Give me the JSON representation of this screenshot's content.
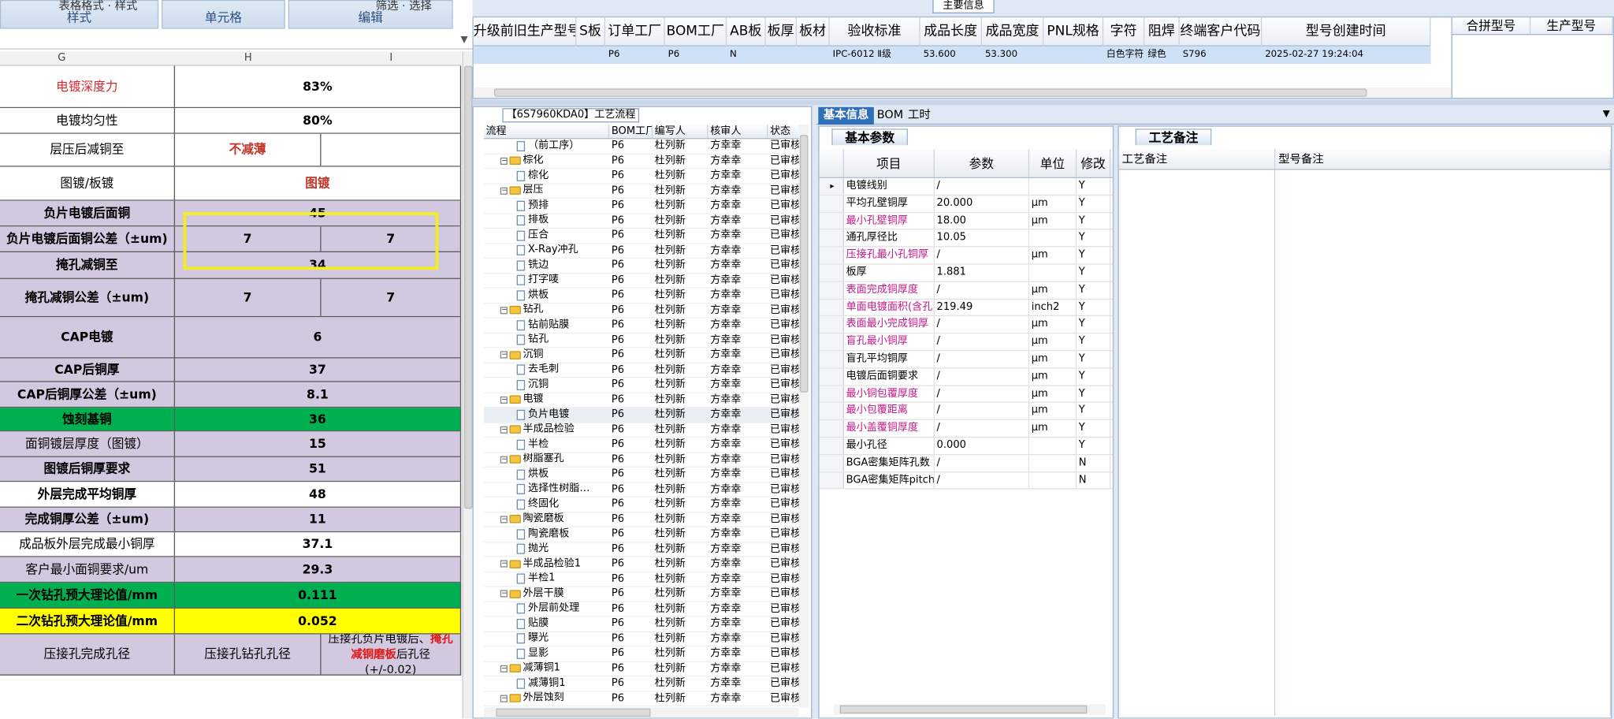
{
  "excel": {
    "ribbon": [
      {
        "label": "样式",
        "top": "表格格式 · 样式"
      },
      {
        "label": "单元格",
        "top": ""
      },
      {
        "label": "编辑",
        "top": "筛选 · 选择"
      }
    ],
    "columns": [
      "G",
      "H",
      "I"
    ],
    "rows": [
      {
        "label": "电镀深度力",
        "v": "83%",
        "bg": "#ffffff",
        "labelColor": "#d7262e",
        "bold": false
      },
      {
        "label": "电镀均匀性",
        "v": "80%",
        "bg": "#ffffff",
        "bold": false
      },
      {
        "label": "层压后减铜至",
        "h": "不减薄",
        "bg": "#ffffff",
        "hColor": "#c0392b",
        "bold": false
      },
      {
        "label": "图镀/板镀",
        "v": "图镀",
        "bg": "#ffffff",
        "vColor": "#c0392b",
        "bold": false
      },
      {
        "label": "负片电镀后面铜",
        "v": "45",
        "bg": "#d2c8df",
        "bold": true
      },
      {
        "label": "负片电镀后面铜公差（±um)",
        "h": "7",
        "i": "7",
        "bg": "#d2c8df",
        "bold": true
      },
      {
        "label": "掩孔减铜至",
        "v": "34",
        "bg": "#d2c8df",
        "bold": true
      },
      {
        "label": "掩孔减铜公差（±um)",
        "h": "7",
        "i": "7",
        "bg": "#d2c8df",
        "bold": true
      },
      {
        "label": "CAP电镀",
        "v": "6",
        "bg": "#d2c8df",
        "bold": true
      },
      {
        "label": "CAP后铜厚",
        "v": "37",
        "bg": "#d2c8df",
        "bold": true
      },
      {
        "label": "CAP后铜厚公差（±um)",
        "v": "8.1",
        "bg": "#d2c8df",
        "bold": true
      },
      {
        "label": "蚀刻基铜",
        "v": "36",
        "bg": "#00b050",
        "bold": true
      },
      {
        "label": "面铜镀层厚度（图镀）",
        "v": "15",
        "bg": "#d2c8df",
        "bold": false
      },
      {
        "label": "图镀后铜厚要求",
        "v": "51",
        "bg": "#d2c8df",
        "bold": true
      },
      {
        "label": "外层完成平均铜厚",
        "v": "48",
        "bg": "#ffffff",
        "bold": true
      },
      {
        "label": "完成铜厚公差（±um)",
        "v": "11",
        "bg": "#d2c8df",
        "bold": true
      },
      {
        "label": "成品板外层完成最小铜厚",
        "v": "37.1",
        "bg": "#ffffff",
        "bold": false
      },
      {
        "label": "客户最小面铜要求/um",
        "v": "29.3",
        "bg": "#d2c8df",
        "bold": false
      },
      {
        "label": "一次钻孔预大理论值/mm",
        "v": "0.111",
        "bg": "#00b050",
        "bold": true
      },
      {
        "label": "二次钻孔预大理论值/mm",
        "v": "0.052",
        "bg": "#ffff00",
        "bold": true
      },
      {
        "label": "压接孔完成孔径",
        "h": "压接孔钻孔孔径",
        "i1": "压接孔负片电镀后、",
        "i2": "掩孔",
        "i3": "减铜磨板",
        "i4": "后孔径",
        "i5": "(+/-0.02)",
        "bg": "#d2c8df",
        "bold": false
      }
    ]
  },
  "app": {
    "main_header": "主要信息",
    "top_columns": [
      "升级前旧生产型号",
      "S板",
      "订单工厂",
      "BOM工厂",
      "AB板",
      "板厚",
      "板材",
      "验收标准",
      "成品长度",
      "成品宽度",
      "PNL规格",
      "字符",
      "阻焊",
      "终端客户代码",
      "型号创建时间"
    ],
    "top_row": [
      "",
      "",
      "P6",
      "P6",
      "N",
      "",
      "",
      "IPC-6012 Ⅱ级",
      "53.600",
      "53.300",
      "",
      "白色字符",
      "绿色",
      "S796",
      "2025-02-27 19:24:04"
    ],
    "side_columns": [
      "合拼型号",
      "生产型号"
    ],
    "process": {
      "caption": "【6S7960KDA0】工艺流程",
      "headers": [
        "流程",
        "BOM工厂",
        "编写人",
        "核审人",
        "状态"
      ],
      "rows": [
        {
          "name": "（前工序）",
          "lvl": 2,
          "f": "P6",
          "w": "杜列新",
          "r": "方幸幸",
          "s": "已审核"
        },
        {
          "name": "棕化",
          "lvl": 1,
          "f": "P6",
          "w": "杜列新",
          "r": "方幸幸",
          "s": "已审核"
        },
        {
          "name": "棕化",
          "lvl": 2,
          "f": "P6",
          "w": "杜列新",
          "r": "方幸幸",
          "s": "已审核"
        },
        {
          "name": "层压",
          "lvl": 1,
          "f": "P6",
          "w": "杜列新",
          "r": "方幸幸",
          "s": "已审核"
        },
        {
          "name": "预排",
          "lvl": 2,
          "f": "P6",
          "w": "杜列新",
          "r": "方幸幸",
          "s": "已审核"
        },
        {
          "name": "排板",
          "lvl": 2,
          "f": "P6",
          "w": "杜列新",
          "r": "方幸幸",
          "s": "已审核"
        },
        {
          "name": "压合",
          "lvl": 2,
          "f": "P6",
          "w": "杜列新",
          "r": "方幸幸",
          "s": "已审核"
        },
        {
          "name": "X-Ray冲孔",
          "lvl": 2,
          "f": "P6",
          "w": "杜列新",
          "r": "方幸幸",
          "s": "已审核"
        },
        {
          "name": "铣边",
          "lvl": 2,
          "f": "P6",
          "w": "杜列新",
          "r": "方幸幸",
          "s": "已审核"
        },
        {
          "name": "打字唛",
          "lvl": 2,
          "f": "P6",
          "w": "杜列新",
          "r": "方幸幸",
          "s": "已审核"
        },
        {
          "name": "烘板",
          "lvl": 2,
          "f": "P6",
          "w": "杜列新",
          "r": "方幸幸",
          "s": "已审核"
        },
        {
          "name": "钻孔",
          "lvl": 1,
          "f": "P6",
          "w": "杜列新",
          "r": "方幸幸",
          "s": "已审核"
        },
        {
          "name": "钻前贴膜",
          "lvl": 2,
          "f": "P6",
          "w": "杜列新",
          "r": "方幸幸",
          "s": "已审核"
        },
        {
          "name": "钻孔",
          "lvl": 2,
          "f": "P6",
          "w": "杜列新",
          "r": "方幸幸",
          "s": "已审核"
        },
        {
          "name": "沉铜",
          "lvl": 1,
          "f": "P6",
          "w": "杜列新",
          "r": "方幸幸",
          "s": "已审核"
        },
        {
          "name": "去毛刺",
          "lvl": 2,
          "f": "P6",
          "w": "杜列新",
          "r": "方幸幸",
          "s": "已审核"
        },
        {
          "name": "沉铜",
          "lvl": 2,
          "f": "P6",
          "w": "杜列新",
          "r": "方幸幸",
          "s": "已审核"
        },
        {
          "name": "电镀",
          "lvl": 1,
          "f": "P6",
          "w": "杜列新",
          "r": "方幸幸",
          "s": "已审核"
        },
        {
          "name": "负片电镀",
          "lvl": 2,
          "f": "P6",
          "w": "杜列新",
          "r": "方幸幸",
          "s": "已审核",
          "sel": true
        },
        {
          "name": "半成品检验",
          "lvl": 1,
          "f": "P6",
          "w": "杜列新",
          "r": "方幸幸",
          "s": "已审核"
        },
        {
          "name": "半检",
          "lvl": 2,
          "f": "P6",
          "w": "杜列新",
          "r": "方幸幸",
          "s": "已审核"
        },
        {
          "name": "树脂塞孔",
          "lvl": 1,
          "f": "P6",
          "w": "杜列新",
          "r": "方幸幸",
          "s": "已审核"
        },
        {
          "name": "烘板",
          "lvl": 2,
          "f": "P6",
          "w": "杜列新",
          "r": "方幸幸",
          "s": "已审核"
        },
        {
          "name": "选择性树脂…",
          "lvl": 2,
          "f": "P6",
          "w": "杜列新",
          "r": "方幸幸",
          "s": "已审核"
        },
        {
          "name": "终固化",
          "lvl": 2,
          "f": "P6",
          "w": "杜列新",
          "r": "方幸幸",
          "s": "已审核"
        },
        {
          "name": "陶瓷磨板",
          "lvl": 1,
          "f": "P6",
          "w": "杜列新",
          "r": "方幸幸",
          "s": "已审核"
        },
        {
          "name": "陶瓷磨板",
          "lvl": 2,
          "f": "P6",
          "w": "杜列新",
          "r": "方幸幸",
          "s": "已审核"
        },
        {
          "name": "抛光",
          "lvl": 2,
          "f": "P6",
          "w": "杜列新",
          "r": "方幸幸",
          "s": "已审核"
        },
        {
          "name": "半成品检验1",
          "lvl": 1,
          "f": "P6",
          "w": "杜列新",
          "r": "方幸幸",
          "s": "已审核"
        },
        {
          "name": "半检1",
          "lvl": 2,
          "f": "P6",
          "w": "杜列新",
          "r": "方幸幸",
          "s": "已审核"
        },
        {
          "name": "外层干膜",
          "lvl": 1,
          "f": "P6",
          "w": "杜列新",
          "r": "方幸幸",
          "s": "已审核"
        },
        {
          "name": "外层前处理",
          "lvl": 2,
          "f": "P6",
          "w": "杜列新",
          "r": "方幸幸",
          "s": "已审核"
        },
        {
          "name": "贴膜",
          "lvl": 2,
          "f": "P6",
          "w": "杜列新",
          "r": "方幸幸",
          "s": "已审核"
        },
        {
          "name": "曝光",
          "lvl": 2,
          "f": "P6",
          "w": "杜列新",
          "r": "方幸幸",
          "s": "已审核"
        },
        {
          "name": "显影",
          "lvl": 2,
          "f": "P6",
          "w": "杜列新",
          "r": "方幸幸",
          "s": "已审核"
        },
        {
          "name": "减薄铜1",
          "lvl": 1,
          "f": "P6",
          "w": "杜列新",
          "r": "方幸幸",
          "s": "已审核"
        },
        {
          "name": "减薄铜1",
          "lvl": 2,
          "f": "P6",
          "w": "杜列新",
          "r": "方幸幸",
          "s": "已审核"
        },
        {
          "name": "外层蚀刻",
          "lvl": 1,
          "f": "P6",
          "w": "杜列新",
          "r": "方幸幸",
          "s": "已审核"
        }
      ]
    },
    "tabs": [
      "基本信息",
      "BOM",
      "工时"
    ],
    "basic": {
      "section": "基本参数",
      "headers": [
        "项目",
        "参数",
        "单位",
        "修改"
      ],
      "rows": [
        {
          "item": "电镀线别",
          "val": "/",
          "unit": "",
          "mod": "Y",
          "pink": false,
          "cur": true
        },
        {
          "item": "平均孔壁铜厚",
          "val": "20.000",
          "unit": "μm",
          "mod": "Y",
          "pink": false
        },
        {
          "item": "最小孔壁铜厚",
          "val": "18.00",
          "unit": "μm",
          "mod": "Y",
          "pink": true
        },
        {
          "item": "通孔厚径比",
          "val": "10.05",
          "unit": "",
          "mod": "Y",
          "pink": false
        },
        {
          "item": "压接孔最小孔铜厚",
          "val": "/",
          "unit": "μm",
          "mod": "Y",
          "pink": true
        },
        {
          "item": "板厚",
          "val": "1.881",
          "unit": "",
          "mod": "Y",
          "pink": false
        },
        {
          "item": "表面完成铜厚度",
          "val": "/",
          "unit": "μm",
          "mod": "Y",
          "pink": true
        },
        {
          "item": "单面电镀面积(含孔)",
          "val": "219.49",
          "unit": "inch2",
          "mod": "Y",
          "pink": true
        },
        {
          "item": "表面最小完成铜厚",
          "val": "/",
          "unit": "μm",
          "mod": "Y",
          "pink": true
        },
        {
          "item": "盲孔最小铜厚",
          "val": "/",
          "unit": "μm",
          "mod": "Y",
          "pink": true
        },
        {
          "item": "盲孔平均铜厚",
          "val": "/",
          "unit": "μm",
          "mod": "Y",
          "pink": false
        },
        {
          "item": "电镀后面铜要求",
          "val": "/",
          "unit": "μm",
          "mod": "Y",
          "pink": false
        },
        {
          "item": "最小铜包覆厚度",
          "val": "/",
          "unit": "μm",
          "mod": "Y",
          "pink": true
        },
        {
          "item": "最小包覆距离",
          "val": "/",
          "unit": "μm",
          "mod": "Y",
          "pink": true
        },
        {
          "item": "最小盖覆铜厚度",
          "val": "/",
          "unit": "μm",
          "mod": "Y",
          "pink": true
        },
        {
          "item": "最小孔径",
          "val": "0.000",
          "unit": "",
          "mod": "Y",
          "pink": false
        },
        {
          "item": "BGA密集矩阵孔数",
          "val": "/",
          "unit": "",
          "mod": "N",
          "pink": false
        },
        {
          "item": "BGA密集矩阵pitch",
          "val": "/",
          "unit": "",
          "mod": "N",
          "pink": false
        }
      ]
    },
    "notes": {
      "section": "工艺备注",
      "headers": [
        "工艺备注",
        "型号备注"
      ]
    }
  }
}
